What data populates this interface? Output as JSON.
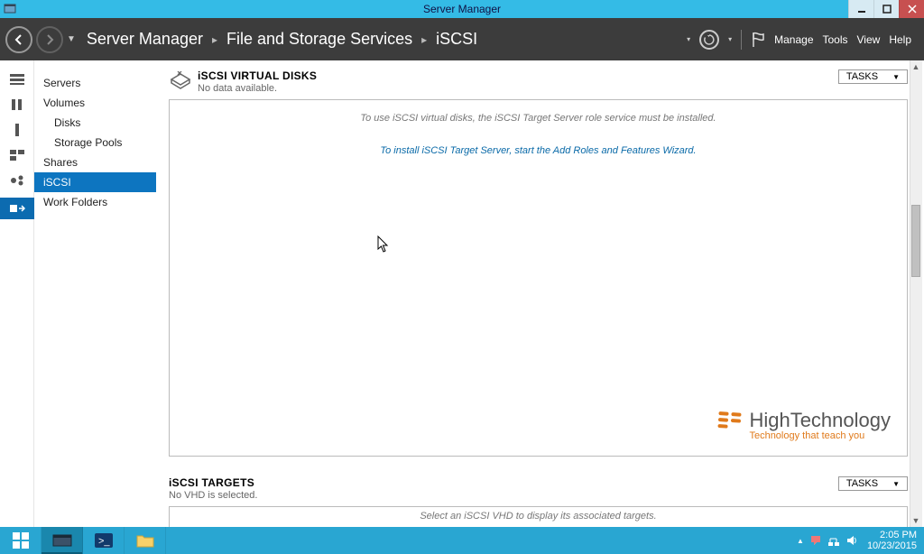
{
  "window": {
    "title": "Server Manager"
  },
  "breadcrumb": {
    "app": "Server Manager",
    "section": "File and Storage Services",
    "page": "iSCSI"
  },
  "menubar": {
    "manage": "Manage",
    "tools": "Tools",
    "view": "View",
    "help": "Help"
  },
  "sidebar": {
    "items": [
      {
        "label": "Servers"
      },
      {
        "label": "Volumes"
      },
      {
        "label": "Disks"
      },
      {
        "label": "Storage Pools"
      },
      {
        "label": "Shares"
      },
      {
        "label": "iSCSI"
      },
      {
        "label": "Work Folders"
      }
    ]
  },
  "sections": {
    "virtual_disks": {
      "title": "iSCSI VIRTUAL DISKS",
      "subtitle": "No data available.",
      "tasks_label": "TASKS",
      "empty_msg": "To use iSCSI virtual disks, the iSCSI Target Server role service must be installed.",
      "link_msg": "To install iSCSI Target Server, start the Add Roles and Features Wizard."
    },
    "targets": {
      "title": "iSCSI TARGETS",
      "subtitle": "No VHD is selected.",
      "tasks_label": "TASKS",
      "empty_msg": "Select an iSCSI VHD to display its associated targets."
    }
  },
  "watermark": {
    "title": "HighTechnology",
    "subtitle": "Technology that teach you"
  },
  "taskbar": {
    "time": "2:05 PM",
    "date": "10/23/2015"
  }
}
